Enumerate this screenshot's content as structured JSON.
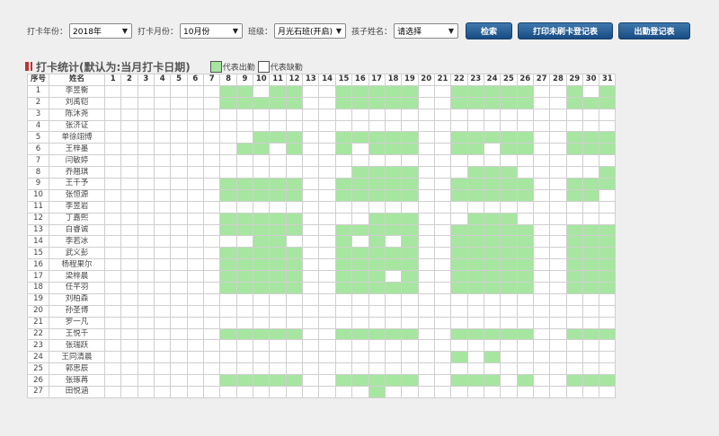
{
  "filters": {
    "year_label": "打卡年份：",
    "year_value": "2018年",
    "month_label": "打卡月份：",
    "month_value": "10月份",
    "class_label": "班级：",
    "class_value": "月光石班(开启)",
    "child_label": "孩子姓名：",
    "child_value": "请选择"
  },
  "buttons": {
    "search": "检索",
    "print_missing": "打印未刷卡登记表",
    "attendance_register": "出勤登记表"
  },
  "section": {
    "title": "打卡统计(默认为:当月打卡日期)",
    "legend_present": "代表出勤",
    "legend_absent": "代表缺勤"
  },
  "colors": {
    "present": "#a6e6a0",
    "absent": "#ffffff",
    "button": "#1f5a94"
  },
  "table": {
    "col_index": "序号",
    "col_name": "姓名",
    "days": 31,
    "rows": [
      {
        "n": "1",
        "name": "李昱衡",
        "present": [
          8,
          9,
          11,
          12,
          15,
          16,
          17,
          18,
          19,
          22,
          23,
          24,
          25,
          26,
          29,
          31
        ]
      },
      {
        "n": "2",
        "name": "刘禹铠",
        "present": [
          8,
          9,
          10,
          11,
          12,
          15,
          16,
          17,
          18,
          19,
          22,
          23,
          24,
          25,
          26,
          29,
          30,
          31
        ]
      },
      {
        "n": "3",
        "name": "陈沐尧",
        "present": []
      },
      {
        "n": "4",
        "name": "张济证",
        "present": []
      },
      {
        "n": "5",
        "name": "单徐翊博",
        "present": [
          10,
          11,
          12,
          15,
          16,
          17,
          18,
          19,
          22,
          23,
          24,
          25,
          26,
          29,
          30,
          31
        ]
      },
      {
        "n": "6",
        "name": "王梓墨",
        "present": [
          9,
          10,
          12,
          15,
          17,
          18,
          19,
          22,
          23,
          25,
          26,
          29,
          30,
          31
        ]
      },
      {
        "n": "7",
        "name": "闫敏婷",
        "present": []
      },
      {
        "n": "8",
        "name": "乔翘琪",
        "present": [
          16,
          17,
          18,
          19,
          23,
          24,
          25,
          31
        ]
      },
      {
        "n": "9",
        "name": "王千予",
        "present": [
          8,
          9,
          10,
          11,
          12,
          15,
          16,
          17,
          18,
          19,
          22,
          23,
          24,
          25,
          26,
          29,
          30,
          31
        ]
      },
      {
        "n": "10",
        "name": "张恒源",
        "present": [
          8,
          9,
          10,
          11,
          12,
          15,
          16,
          17,
          18,
          19,
          22,
          23,
          24,
          25,
          26,
          29,
          30
        ]
      },
      {
        "n": "11",
        "name": "李昱岩",
        "present": []
      },
      {
        "n": "12",
        "name": "丁嘉熙",
        "present": [
          8,
          9,
          10,
          11,
          12,
          17,
          18,
          19,
          23,
          24,
          25
        ]
      },
      {
        "n": "13",
        "name": "白睿诚",
        "present": [
          8,
          9,
          10,
          11,
          12,
          15,
          16,
          17,
          18,
          19,
          22,
          23,
          24,
          25,
          26,
          29,
          30,
          31
        ]
      },
      {
        "n": "14",
        "name": "李若冰",
        "present": [
          10,
          11,
          15,
          17,
          19,
          22,
          23,
          24,
          25,
          26,
          29,
          30,
          31
        ]
      },
      {
        "n": "15",
        "name": "武义彭",
        "present": [
          8,
          9,
          10,
          11,
          12,
          15,
          16,
          17,
          18,
          19,
          22,
          23,
          24,
          25,
          26,
          29,
          30,
          31
        ]
      },
      {
        "n": "16",
        "name": "杨程果尔",
        "present": [
          8,
          9,
          10,
          11,
          12,
          15,
          16,
          17,
          18,
          19,
          22,
          23,
          24,
          25,
          26,
          29,
          30,
          31
        ]
      },
      {
        "n": "17",
        "name": "梁梓晨",
        "present": [
          8,
          9,
          10,
          11,
          12,
          15,
          16,
          17,
          19,
          22,
          23,
          24,
          25,
          26,
          29,
          30,
          31
        ]
      },
      {
        "n": "18",
        "name": "任芊羽",
        "present": [
          8,
          9,
          10,
          11,
          12,
          15,
          16,
          17,
          18,
          19,
          22,
          23,
          24,
          25,
          26,
          29,
          30,
          31
        ]
      },
      {
        "n": "19",
        "name": "刘柏森",
        "present": []
      },
      {
        "n": "20",
        "name": "孙圣博",
        "present": []
      },
      {
        "n": "21",
        "name": "罗一凡",
        "present": []
      },
      {
        "n": "22",
        "name": "王悦千",
        "present": [
          8,
          9,
          10,
          11,
          12,
          15,
          16,
          17,
          18,
          19,
          22,
          23,
          24,
          25,
          26,
          29,
          30,
          31
        ]
      },
      {
        "n": "23",
        "name": "张瑞跃",
        "present": []
      },
      {
        "n": "24",
        "name": "王同清晨",
        "present": [
          22,
          24
        ]
      },
      {
        "n": "25",
        "name": "郭思辰",
        "present": []
      },
      {
        "n": "26",
        "name": "张琢苒",
        "present": [
          8,
          9,
          10,
          11,
          12,
          15,
          16,
          17,
          18,
          19,
          22,
          23,
          24,
          26,
          29,
          30,
          31
        ]
      },
      {
        "n": "27",
        "name": "田悦涵",
        "present": [
          17
        ]
      }
    ]
  }
}
